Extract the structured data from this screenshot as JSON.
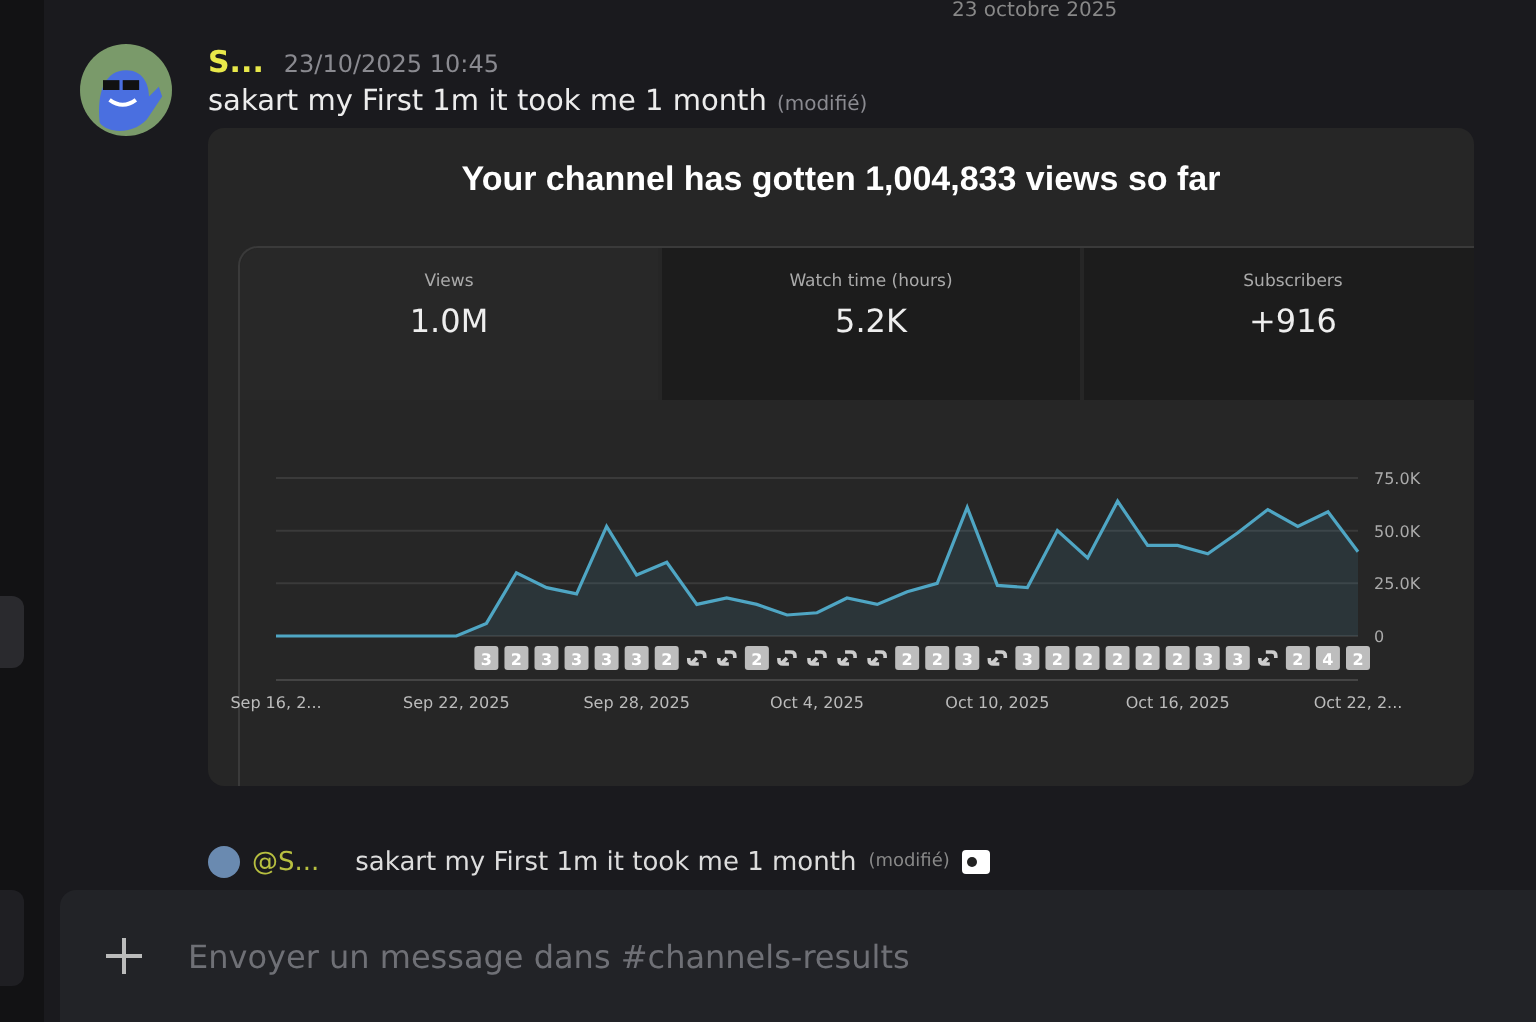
{
  "date_divider": "23 octobre 2025",
  "message": {
    "author": "S...",
    "timestamp": "23/10/2025 10:45",
    "text": "sakart my First 1m it took me 1 month",
    "edited": "(modifié)",
    "embed": {
      "title": "Your channel has gotten 1,004,833 views so far",
      "stats": [
        {
          "label": "Views",
          "value": "1.0M",
          "selected": true
        },
        {
          "label": "Watch time (hours)",
          "value": "5.2K",
          "selected": false
        },
        {
          "label": "Subscribers",
          "value": "+916",
          "selected": false
        }
      ],
      "chart_data": {
        "type": "area",
        "categories": [
          "Sep 16, 2...",
          null,
          null,
          null,
          null,
          null,
          "Sep 22, 2025",
          null,
          null,
          null,
          null,
          null,
          "Sep 28, 2025",
          null,
          null,
          null,
          null,
          null,
          "Oct 4, 2025",
          null,
          null,
          null,
          null,
          null,
          "Oct 10, 2025",
          null,
          null,
          null,
          null,
          null,
          "Oct 16, 2025",
          null,
          null,
          null,
          null,
          null,
          "Oct 22, 2..."
        ],
        "series": [
          {
            "color": "#4fa6c4",
            "values": [
              0,
              0,
              0,
              0,
              0,
              0,
              0,
              6000,
              30000,
              23000,
              20000,
              52000,
              29000,
              35000,
              15000,
              18000,
              15000,
              10000,
              11000,
              18000,
              15000,
              21000,
              25000,
              61000,
              24000,
              23000,
              50000,
              37000,
              64000,
              43000,
              43000,
              39000,
              49000,
              60000,
              52000,
              59000,
              40000
            ]
          }
        ],
        "ylim": [
          0,
          75000
        ],
        "yticks": [
          {
            "value": 0,
            "label": "0"
          },
          {
            "value": 25000,
            "label": "25.0K"
          },
          {
            "value": 50000,
            "label": "50.0K"
          },
          {
            "value": 75000,
            "label": "75.0K"
          }
        ]
      },
      "markers": [
        {
          "kind": "count",
          "text": "3"
        },
        {
          "kind": "count",
          "text": "2"
        },
        {
          "kind": "count",
          "text": "3"
        },
        {
          "kind": "count",
          "text": "3"
        },
        {
          "kind": "count",
          "text": "3"
        },
        {
          "kind": "count",
          "text": "3"
        },
        {
          "kind": "count",
          "text": "2"
        },
        {
          "kind": "link"
        },
        {
          "kind": "link"
        },
        {
          "kind": "count",
          "text": "2"
        },
        {
          "kind": "link"
        },
        {
          "kind": "link"
        },
        {
          "kind": "link"
        },
        {
          "kind": "link"
        },
        {
          "kind": "count",
          "text": "2"
        },
        {
          "kind": "count",
          "text": "2"
        },
        {
          "kind": "count",
          "text": "3"
        },
        {
          "kind": "link"
        },
        {
          "kind": "count",
          "text": "3"
        },
        {
          "kind": "count",
          "text": "2"
        },
        {
          "kind": "count",
          "text": "2"
        },
        {
          "kind": "count",
          "text": "2"
        },
        {
          "kind": "count",
          "text": "2"
        },
        {
          "kind": "count",
          "text": "2"
        },
        {
          "kind": "count",
          "text": "3"
        },
        {
          "kind": "count",
          "text": "3"
        },
        {
          "kind": "link"
        },
        {
          "kind": "count",
          "text": "2"
        },
        {
          "kind": "count",
          "text": "4"
        },
        {
          "kind": "count",
          "text": "2"
        }
      ]
    }
  },
  "reply_preview": {
    "author": "@S...",
    "text": "sakart my First 1m it took me 1 month",
    "edited": "(modifié)"
  },
  "composer": {
    "placeholder": "Envoyer un message dans #channels-results"
  }
}
